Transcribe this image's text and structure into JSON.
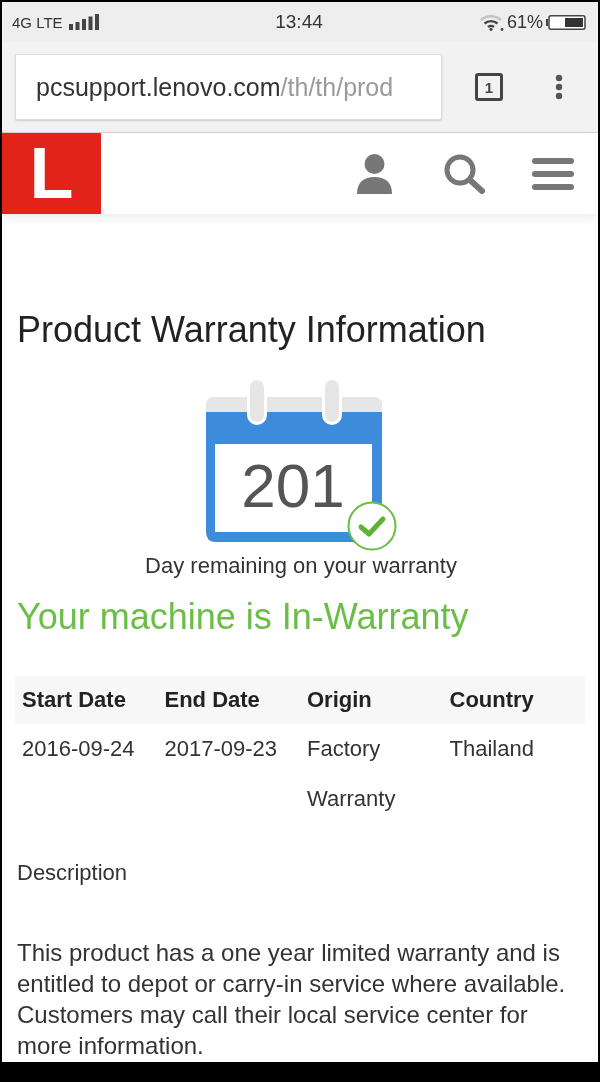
{
  "status_bar": {
    "network": "4G LTE",
    "time": "13:44",
    "battery": "61%"
  },
  "browser": {
    "url": {
      "host": "pcsupport.lenovo.com",
      "path": "/th/th/prod"
    },
    "tab_count": "1"
  },
  "site_header": {
    "logo": "L"
  },
  "warranty": {
    "title": "Product Warranty Information",
    "days_remaining": "201",
    "days_caption": "Day remaining on your warranty",
    "status": "Your machine is In-Warranty"
  },
  "table": {
    "columns": [
      "Start Date",
      "End Date",
      "Origin",
      "Country"
    ],
    "rows": [
      [
        "2016-09-24",
        "2017-09-23",
        "Factory Warranty",
        "Thailand"
      ]
    ]
  },
  "description": {
    "heading": "Description",
    "text": "This product has a one year limited warranty and is entitled to depot or carry-in service where available. Customers may call their local service center for more information."
  }
}
